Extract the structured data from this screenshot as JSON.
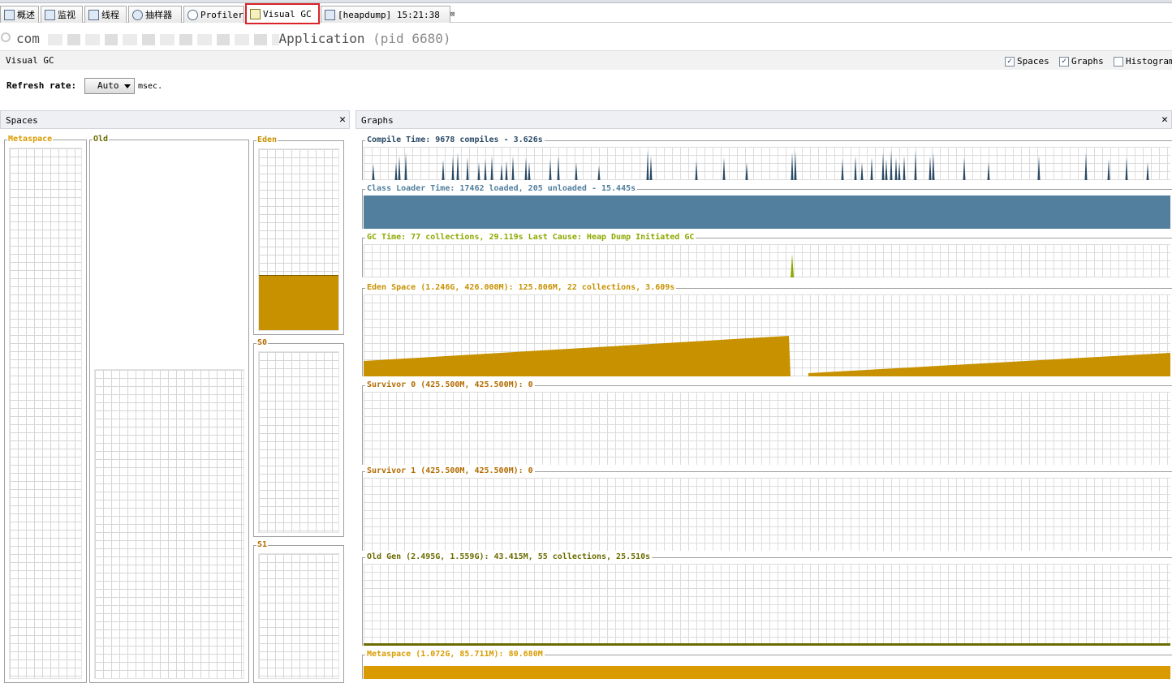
{
  "tabs": [
    {
      "label": "概述"
    },
    {
      "label": "监视"
    },
    {
      "label": "线程"
    },
    {
      "label": "抽样器"
    },
    {
      "label": "Profiler"
    },
    {
      "label": "Visual GC"
    },
    {
      "label": "[heapdump] 15:21:38"
    }
  ],
  "app": {
    "name_prefix": "com",
    "name_suffix": "Application",
    "pid": "(pid 6680)"
  },
  "toolbar": {
    "view_label": "Visual GC",
    "spaces_label": "Spaces",
    "graphs_label": "Graphs",
    "histogram_label": "Histogram",
    "refresh_label": "Refresh rate:",
    "refresh_value": "Auto",
    "refresh_unit": "msec."
  },
  "panels": {
    "spaces_title": "Spaces",
    "graphs_title": "Graphs",
    "close": "✕"
  },
  "spaces": {
    "metaspace": "Metaspace",
    "old": "Old",
    "eden": "Eden",
    "s0": "S0",
    "s1": "S1"
  },
  "graphs": {
    "compile": "Compile Time: 9678 compiles - 3.626s",
    "classloader": "Class Loader Time: 17462 loaded, 205 unloaded - 15.445s",
    "gc": "GC Time: 77 collections, 29.119s  Last Cause: Heap Dump Initiated GC",
    "eden": "Eden Space (1.246G, 426.000M): 125.806M, 22 collections, 3.609s",
    "survivor0": "Survivor 0 (425.500M, 425.500M): 0",
    "survivor1": "Survivor 1 (425.500M, 425.500M): 0",
    "oldgen": "Old Gen (2.495G, 1.559G): 43.415M, 55 collections, 25.510s",
    "metaspace": "Metaspace (1.072G, 85.711M): 80.680M"
  },
  "colors": {
    "compile": "#2b4b66",
    "classloader": "#527f9e",
    "gc": "#8ea800",
    "eden": "#c79100",
    "survivor": "#b36b00",
    "oldgen": "#6b6b00",
    "meta": "#d99b00"
  }
}
